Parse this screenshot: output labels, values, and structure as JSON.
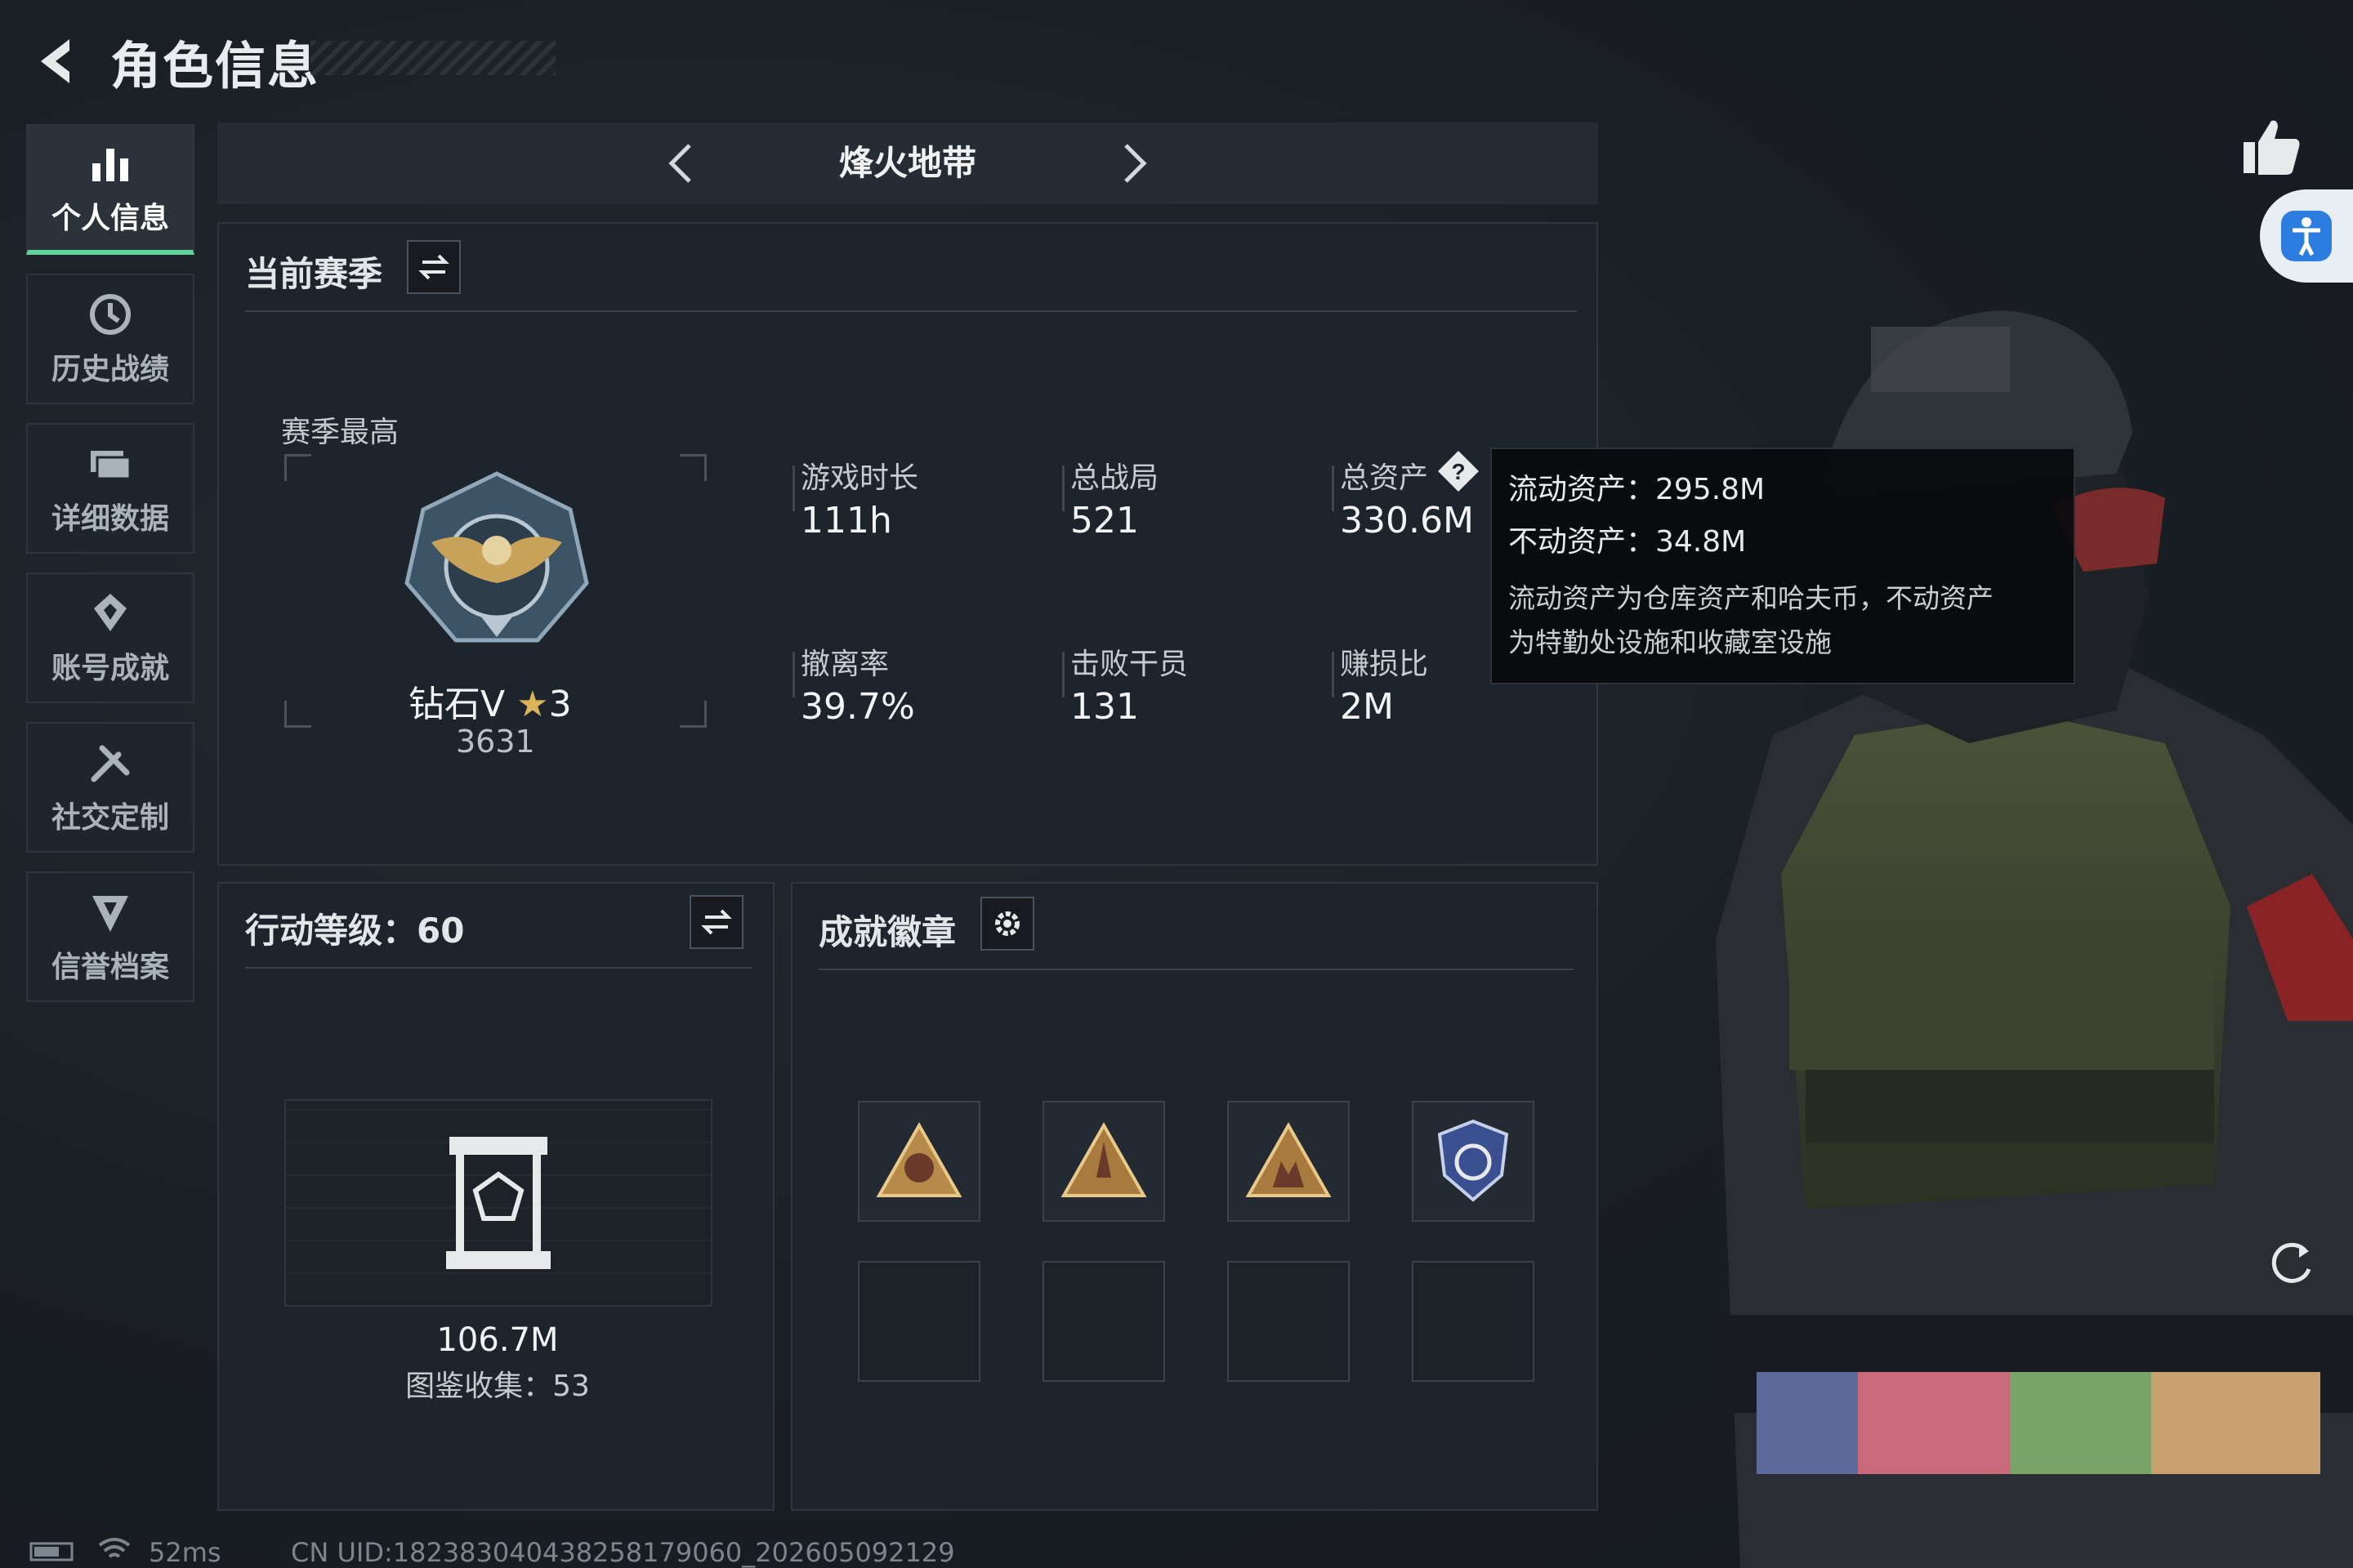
{
  "header": {
    "title": "角色信息"
  },
  "sidebar": {
    "items": [
      {
        "label": "个人信息",
        "icon": "bar-chart-icon",
        "active": true
      },
      {
        "label": "历史战绩",
        "icon": "history-clock-icon",
        "active": false
      },
      {
        "label": "详细数据",
        "icon": "folder-icon",
        "active": false
      },
      {
        "label": "账号成就",
        "icon": "achievement-icon",
        "active": false
      },
      {
        "label": "社交定制",
        "icon": "tools-icon",
        "active": false
      },
      {
        "label": "信誉档案",
        "icon": "shield-icon",
        "active": false
      }
    ]
  },
  "mode": {
    "name": "烽火地带"
  },
  "season": {
    "title": "当前赛季",
    "best_label": "赛季最高",
    "rank_name": "钻石V",
    "rank_stars": "3",
    "rank_points": "3631",
    "stats": [
      {
        "label": "游戏时长",
        "value": "111h"
      },
      {
        "label": "总战局",
        "value": "521"
      },
      {
        "label": "总资产",
        "value": "330.6M"
      },
      {
        "label": "撤离率",
        "value": "39.7%"
      },
      {
        "label": "击败干员",
        "value": "131"
      },
      {
        "label": "赚损比",
        "value": "2M"
      }
    ]
  },
  "tooltip": {
    "liquid": "流动资产：295.8M",
    "fixed": "不动资产：34.8M",
    "desc1": "流动资产为仓库资产和哈夫币，不动资产",
    "desc2": "为特勤处设施和收藏室设施"
  },
  "action_level": {
    "title": "行动等级：60",
    "value": "106.7M",
    "collection": "图鉴收集：53"
  },
  "badges": {
    "title": "成就徽章",
    "items": [
      "badge-58-icon",
      "badge-rocket-icon",
      "badge-squad-icon",
      "badge-shield-icon"
    ]
  },
  "status": {
    "ping": "52ms",
    "uid": "CN UID:1823830404382581790​60_202605092129"
  },
  "colors": {
    "accent": "#5fd39a",
    "bg": "#1a1f25",
    "access_btn": "#2d7de0"
  }
}
